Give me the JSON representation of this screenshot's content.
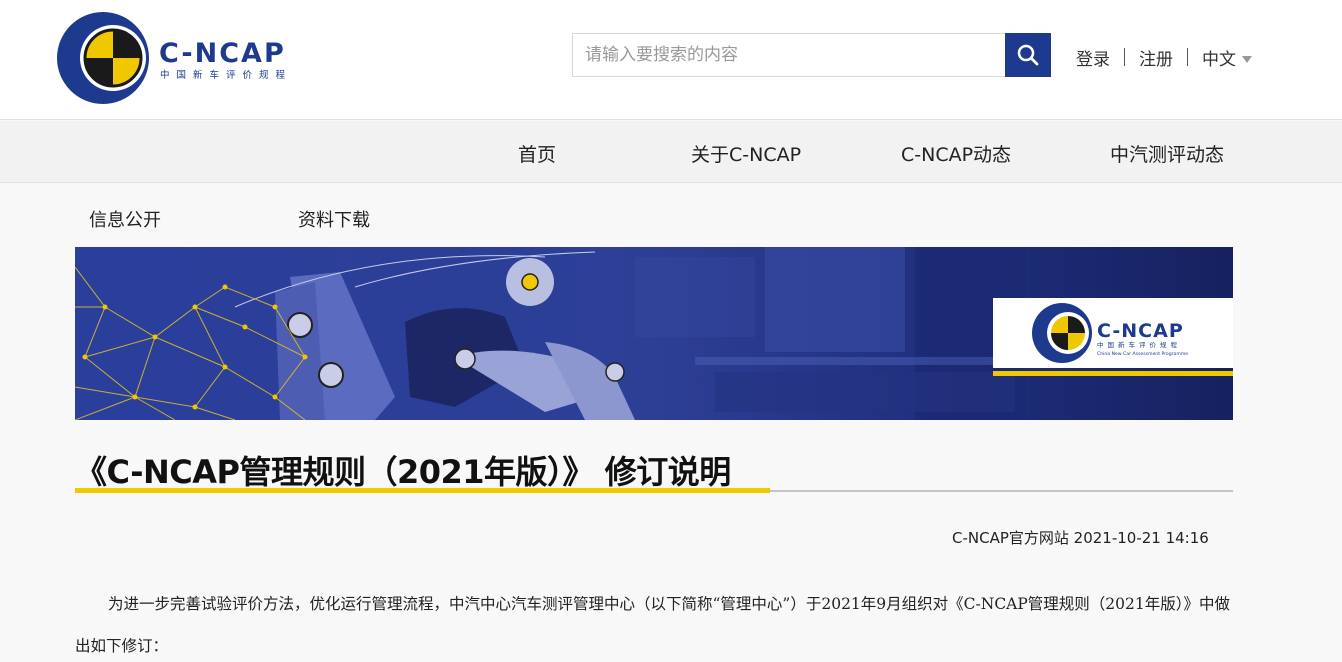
{
  "brand": {
    "name": "C-NCAP",
    "subtitle": "中国新车评价规程",
    "subtitle_en": "China New Car Assessment Programme"
  },
  "search": {
    "placeholder": "请输入要搜索的内容",
    "icon": "search-icon"
  },
  "top_links": {
    "login": "登录",
    "register": "注册",
    "language": "中文"
  },
  "main_nav": [
    {
      "label": "首页"
    },
    {
      "label": "关于C-NCAP"
    },
    {
      "label": "C-NCAP动态"
    },
    {
      "label": "中汽测评动态"
    }
  ],
  "sub_nav": [
    {
      "label": "信息公开"
    },
    {
      "label": "资料下载"
    }
  ],
  "article": {
    "title": "《C-NCAP管理规则（2021年版）》 修订说明",
    "source_date": "C-NCAP官方网站 2021-10-21 14:16",
    "paragraph": "为进一步完善试验评价方法，优化运行管理流程，中汽中心汽车测评管理中心（以下简称“管理中心”）于2021年9月组织对《C-NCAP管理规则（2021年版）》中做出如下修订："
  },
  "colors": {
    "brand_blue": "#1d3a8e",
    "brand_yellow": "#f0c800",
    "banner_blue": "#1a2b78"
  }
}
